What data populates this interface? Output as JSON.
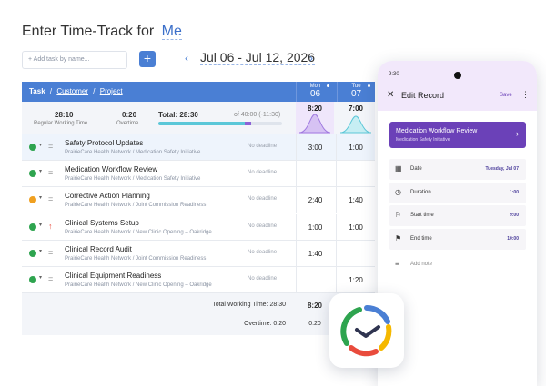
{
  "header": {
    "title_prefix": "Enter Time-Track for",
    "title_user": "Me"
  },
  "toolbar": {
    "add_task_placeholder": "+ Add task by name...",
    "add_button_label": "+",
    "prev_label": "‹",
    "next_label": "›",
    "date_range": "Jul 06 - Jul 12, 2026"
  },
  "table": {
    "task_header": "Task",
    "customer_link": "Customer",
    "sep1": "/",
    "project_link": "Project",
    "sep2": "/",
    "days": [
      {
        "name": "Mon",
        "num": "06"
      },
      {
        "name": "Tue",
        "num": "07"
      }
    ],
    "summary": {
      "regular_value": "28:10",
      "regular_label": "Regular Working Time",
      "overtime_value": "0:20",
      "overtime_label": "Overtime",
      "total_label": "Total: 28:30",
      "of_label": "of 40:00 (-11:30)",
      "progress_fraction": 0.7,
      "overtime_fraction": 0.05,
      "mon_value": "8:20",
      "tue_value": "7:00"
    },
    "rows": [
      {
        "name": "Safety Protocol Updates",
        "path": "PrairieCare Health Network / Medication Safety Initiative",
        "deadline": "No deadline",
        "mon": "3:00",
        "tue": "1:00",
        "status_color": "#2ea44f",
        "selected": true
      },
      {
        "name": "Medication Workflow Review",
        "path": "PrairieCare Health Network / Medication Safety Initiative",
        "deadline": "No deadline",
        "mon": "",
        "tue": "",
        "status_color": "#2ea44f",
        "selected": false
      },
      {
        "name": "Corrective Action Planning",
        "path": "PrairieCare Health Network / Joint Commission Readiness",
        "deadline": "No deadline",
        "mon": "2:40",
        "tue": "1:40",
        "status_color": "#f0a020",
        "selected": false
      },
      {
        "name": "Clinical Systems Setup",
        "path": "PrairieCare Health Network / New Clinic Opening – Oakridge",
        "deadline": "No deadline",
        "mon": "1:00",
        "tue": "1:00",
        "status_color": "#2ea44f",
        "selected": false
      },
      {
        "name": "Clinical Record Audit",
        "path": "PrairieCare Health Network / Joint Commission Readiness",
        "deadline": "No deadline",
        "mon": "1:40",
        "tue": "",
        "status_color": "#2ea44f",
        "selected": false
      },
      {
        "name": "Clinical Equipment Readiness",
        "path": "PrairieCare Health Network / New Clinic Opening – Oakridge",
        "deadline": "No deadline",
        "mon": "",
        "tue": "1:20",
        "status_color": "#2ea44f",
        "selected": false
      }
    ],
    "footer": {
      "total_label": "Total Working Time: 28:30",
      "total_mon": "8:20",
      "overtime_label": "Overtime: 0:20",
      "overtime_mon": "0:20"
    }
  },
  "phone": {
    "time": "9:30",
    "title": "Edit Record",
    "save_label": "Save",
    "task_name": "Medication Workflow Review",
    "task_path": "Medication Safety Initiative",
    "fields": [
      {
        "label": "Date",
        "value": "Tuesday, Jul 07",
        "icon": "calendar-icon",
        "glyph": "▦"
      },
      {
        "label": "Duration",
        "value": "1:00",
        "icon": "clock-icon",
        "glyph": "◷"
      },
      {
        "label": "Start time",
        "value": "9:00",
        "icon": "flag-start-icon",
        "glyph": "⚐"
      },
      {
        "label": "End time",
        "value": "10:00",
        "icon": "flag-end-icon",
        "glyph": "⚑"
      }
    ],
    "note_placeholder": "Add note"
  },
  "colors": {
    "primary": "#4a7fd4",
    "purple": "#6b41b8",
    "green": "#2ea44f",
    "orange": "#f0a020"
  }
}
